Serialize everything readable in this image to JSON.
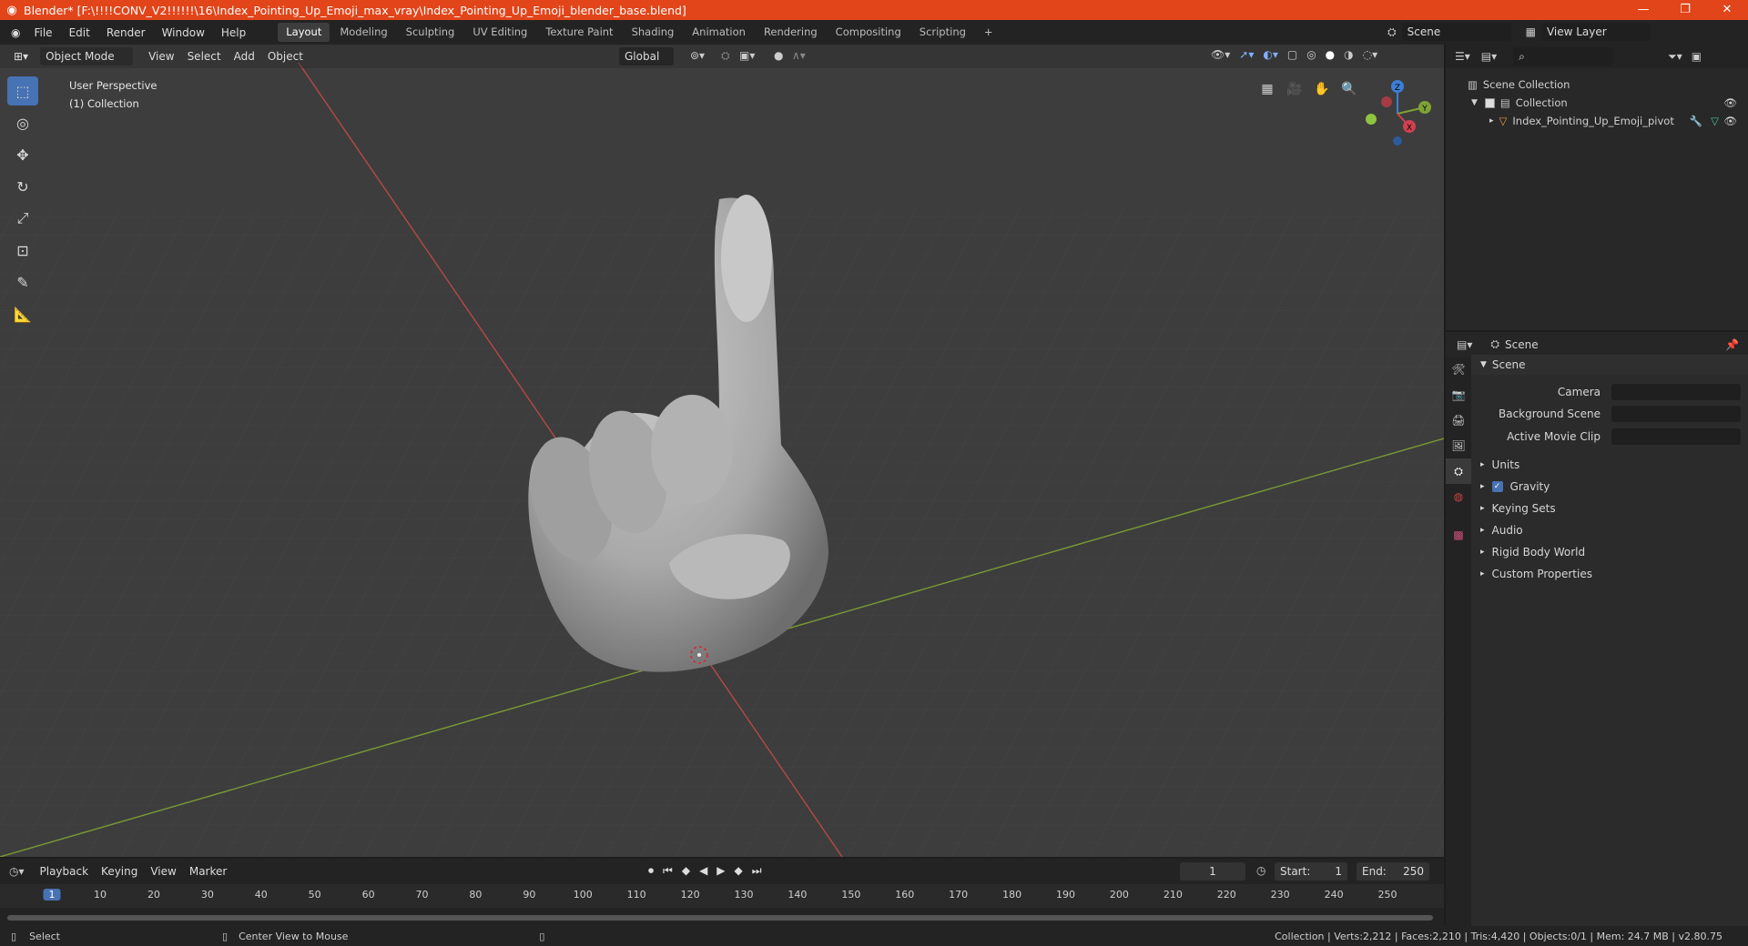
{
  "window": {
    "title": "Blender* [F:\\!!!!CONV_V2!!!!!!\\16\\Index_Pointing_Up_Emoji_max_vray\\Index_Pointing_Up_Emoji_blender_base.blend]"
  },
  "menu": [
    "File",
    "Edit",
    "Render",
    "Window",
    "Help"
  ],
  "workspaces": [
    "Layout",
    "Modeling",
    "Sculpting",
    "UV Editing",
    "Texture Paint",
    "Shading",
    "Animation",
    "Rendering",
    "Compositing",
    "Scripting"
  ],
  "scene_field": "Scene",
  "view_layer_field": "View Layer",
  "viewport": {
    "mode": "Object Mode",
    "menus": [
      "View",
      "Select",
      "Add",
      "Object"
    ],
    "transform": "Global",
    "overlay_line1": "User Perspective",
    "overlay_line2": "(1) Collection"
  },
  "gizmo": {
    "z": "Z",
    "y": "Y",
    "x": "X"
  },
  "outliner": {
    "root": "Scene Collection",
    "collection": "Collection",
    "object": "Index_Pointing_Up_Emoji_pivot"
  },
  "properties": {
    "header": "Scene",
    "panel": "Scene",
    "camera_label": "Camera",
    "bg_label": "Background Scene",
    "clip_label": "Active Movie Clip",
    "sections": [
      "Units",
      "Gravity",
      "Keying Sets",
      "Audio",
      "Rigid Body World",
      "Custom Properties"
    ]
  },
  "timeline": {
    "menus": [
      "Playback",
      "Keying",
      "View",
      "Marker"
    ],
    "current_frame": "1",
    "start_label": "Start:",
    "start": "1",
    "end_label": "End:",
    "end": "250",
    "ticks": [
      "1",
      "10",
      "20",
      "30",
      "40",
      "50",
      "60",
      "70",
      "80",
      "90",
      "100",
      "110",
      "120",
      "130",
      "140",
      "150",
      "160",
      "170",
      "180",
      "190",
      "200",
      "210",
      "220",
      "230",
      "240",
      "250"
    ]
  },
  "status": {
    "left": "Select",
    "middle": "Center View to Mouse",
    "right": "Collection | Verts:2,212 | Faces:2,210 | Tris:4,420 | Objects:0/1 | Mem: 24.7 MB | v2.80.75"
  },
  "colors": {
    "title_bar": "#e2451a",
    "accent": "#4772b3",
    "x_axis": "#c84040",
    "y_axis": "#7fa236"
  }
}
